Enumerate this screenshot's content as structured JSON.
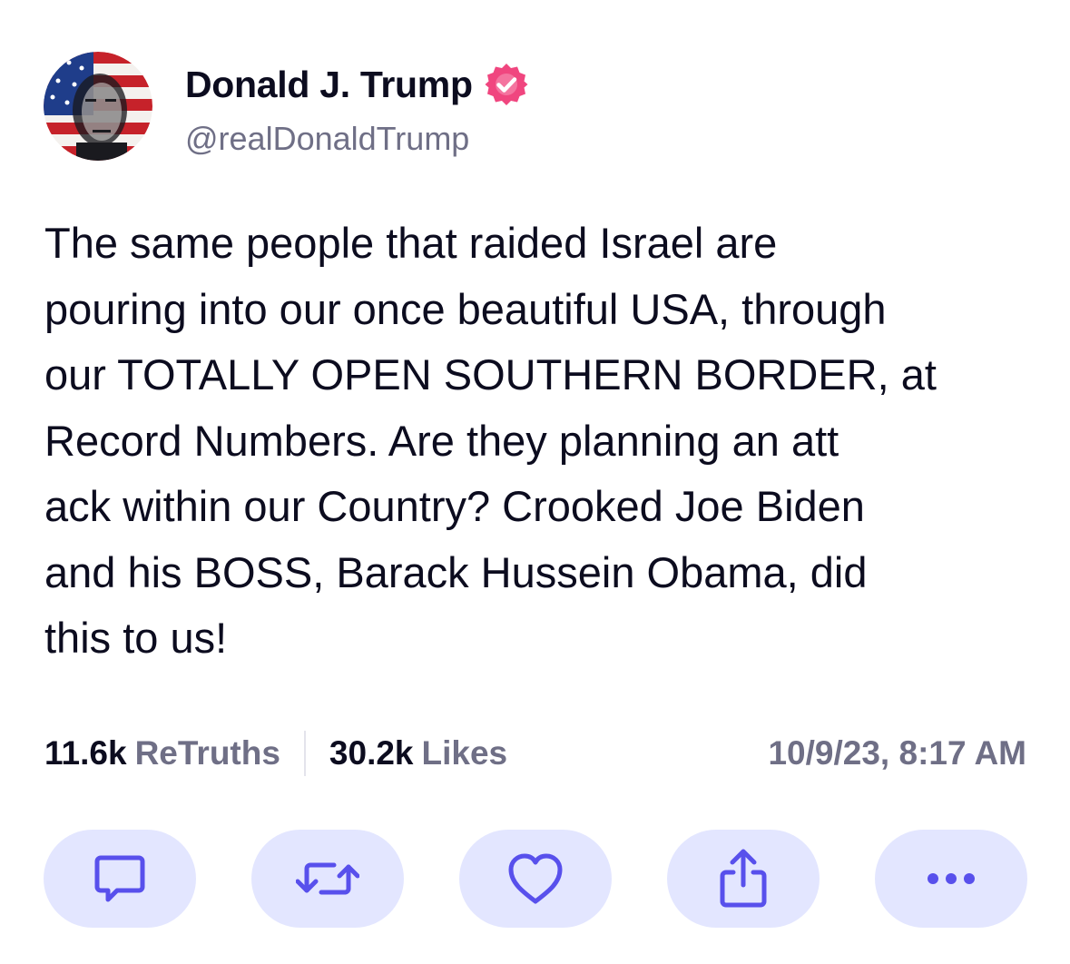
{
  "author": {
    "display_name": "Donald J. Trump",
    "handle": "@realDonaldTrump",
    "verified": true,
    "avatar_icon": "avatar-flag-portrait"
  },
  "post": {
    "lines": [
      "The same people that raided Israel are",
      "pouring into our once beautiful USA, through",
      "our TOTALLY OPEN SOUTHERN BORDER, at",
      "Record Numbers. Are they planning an att",
      "ack within our Country? Crooked Joe Biden",
      "and his BOSS, Barack Hussein Obama, did",
      "this to us!"
    ]
  },
  "stats": {
    "retruths_count": "11.6k",
    "retruths_label": "ReTruths",
    "likes_count": "30.2k",
    "likes_label": "Likes",
    "timestamp": "10/9/23, 8:17 AM"
  },
  "actions": [
    {
      "name": "reply",
      "icon": "speech-bubble-icon"
    },
    {
      "name": "retruth",
      "icon": "repost-arrows-icon"
    },
    {
      "name": "like",
      "icon": "heart-icon"
    },
    {
      "name": "share",
      "icon": "share-icon"
    },
    {
      "name": "more",
      "icon": "ellipsis-icon"
    }
  ],
  "colors": {
    "text_primary": "#0c0c1f",
    "text_secondary": "#6f6f86",
    "verified_badge": "#f0467f",
    "action_bg": "#e3e6ff",
    "action_icon": "#5850ec"
  }
}
